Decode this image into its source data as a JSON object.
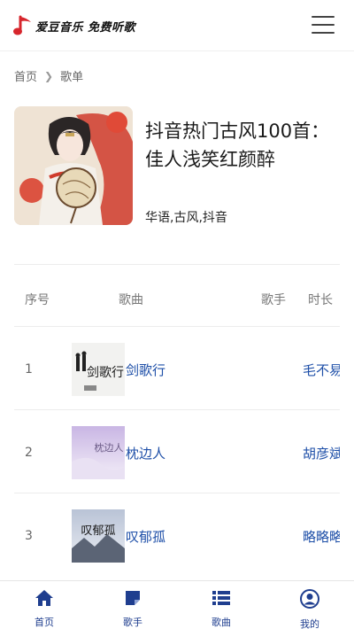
{
  "header": {
    "logo_text": "爱豆音乐 免费听歌",
    "menu_icon": "hamburger-menu-icon",
    "brand_color": "#d7262d"
  },
  "breadcrumb": {
    "home": "首页",
    "current": "歌单"
  },
  "playlist": {
    "title": "抖音热门古风100首：佳人浅笑红颜醉",
    "tags": "华语,古风,抖音"
  },
  "table": {
    "headers": {
      "index": "序号",
      "song": "歌曲",
      "artist": "歌手",
      "duration": "时长"
    },
    "rows": [
      {
        "index": "1",
        "song": "剑歌行",
        "artist": "毛不易",
        "cover_text": "剑歌行"
      },
      {
        "index": "2",
        "song": "枕边人",
        "artist": "胡彦斌",
        "cover_text": "枕边人"
      },
      {
        "index": "3",
        "song": "叹郁孤",
        "artist": "略略略",
        "cover_text": "叹郁孤"
      }
    ]
  },
  "nav": {
    "accent_color": "#1f3e8f",
    "items": [
      {
        "label": "首页",
        "icon": "home-icon"
      },
      {
        "label": "歌手",
        "icon": "singer-icon"
      },
      {
        "label": "歌曲",
        "icon": "song-list-icon"
      },
      {
        "label": "我的",
        "icon": "user-icon"
      }
    ]
  }
}
